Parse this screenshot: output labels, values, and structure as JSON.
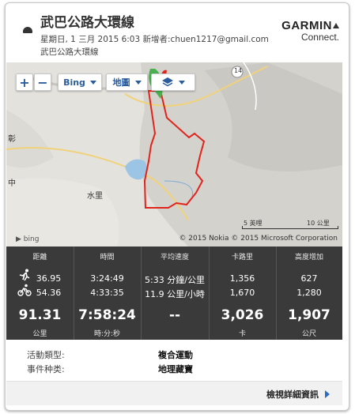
{
  "header": {
    "title": "武巴公路大環線",
    "meta": "星期日, 1 三月 2015 6:03 新增者:chuen1217@gmail.com",
    "location": "武巴公路大環線",
    "logo_top": "GARMIN",
    "logo_bottom": "Connect."
  },
  "map": {
    "zoom_in": "+",
    "zoom_out": "−",
    "provider_button": "Bing",
    "type_button": "地圖",
    "label_water": "水里",
    "label_side": "中",
    "label_side2": "彰",
    "road_number": "14",
    "scale_km": "5 英哩",
    "scale_mi": "10 公里",
    "attribution": "© 2015 Nokia  © 2015 Microsoft Corporation",
    "bing_mark": "bing",
    "route_color": "#e0241b",
    "pin_color": "#4caf50"
  },
  "stats": {
    "columns": [
      {
        "header": "距離",
        "line1": "36.95",
        "line2": "54.36",
        "total": "91.31",
        "unit": "公里"
      },
      {
        "header": "時間",
        "line1": "3:24:49",
        "line2": "4:33:35",
        "total": "7:58:24",
        "unit": "時:分:秒"
      },
      {
        "header": "平均速度",
        "line1": "5:33 分鐘/公里",
        "line2": "11.9 公里/小時",
        "total": "--",
        "unit": ""
      },
      {
        "header": "卡路里",
        "line1": "1,356",
        "line2": "1,670",
        "total": "3,026",
        "unit": "卡"
      },
      {
        "header": "高度增加",
        "line1": "627",
        "line2": "1,280",
        "total": "1,907",
        "unit": "公尺"
      }
    ]
  },
  "info": {
    "type_label": "活動類型:",
    "type_value": "複合運動",
    "event_label": "事件种类:",
    "event_value": "地理藏寶"
  },
  "footer": {
    "detail_link": "檢視詳細資訊"
  }
}
